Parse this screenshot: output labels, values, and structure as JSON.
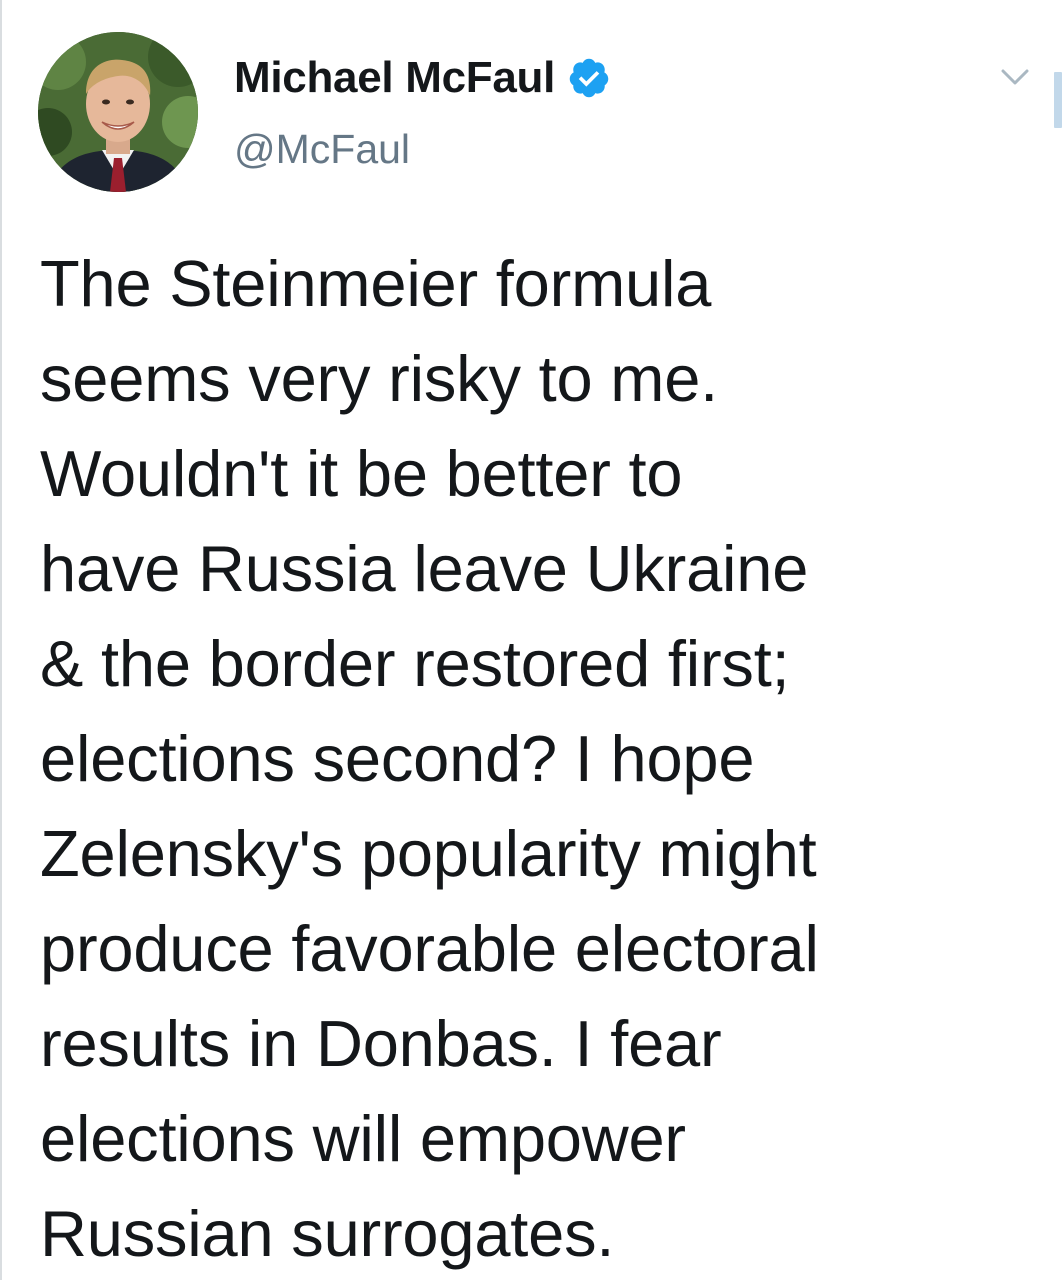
{
  "tweet": {
    "author": {
      "display_name": "Michael McFaul",
      "handle": "@McFaul",
      "verified": true,
      "verified_icon": "verified-badge-icon",
      "avatar_icon": "profile-photo"
    },
    "menu_icon": "chevron-down-icon",
    "text_lines": [
      "The Steinmeier formula",
      "seems very risky to me.",
      "Wouldn't it be better to",
      "have Russia leave Ukraine",
      "& the border restored first;",
      "elections second? I hope",
      "Zelensky's popularity might",
      "produce favorable electoral",
      "results in Donbas. I fear",
      "elections will empower",
      "Russian surrogates."
    ]
  },
  "colors": {
    "text": "#14171a",
    "secondary_text": "#657786",
    "verified_blue": "#1da1f2",
    "background": "#ffffff",
    "caret": "#aab8c2"
  }
}
